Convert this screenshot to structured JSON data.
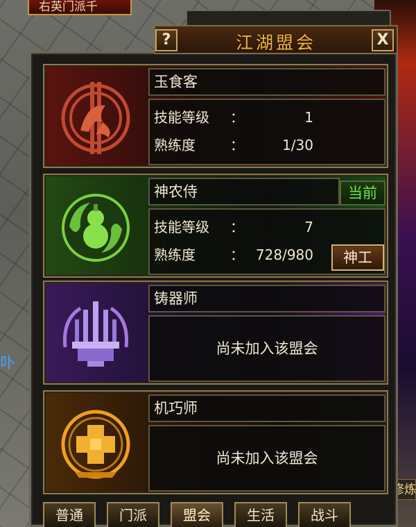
{
  "background": {
    "top_strip_text": "右英门派千",
    "left_fragment_text": "卟",
    "right_fragment_text": "修炼"
  },
  "window": {
    "title": "江湖盟会",
    "help_label": "?",
    "close_label": "X"
  },
  "guilds": [
    {
      "name": "玉食客",
      "skill_level_label": "技能等级",
      "skill_level_value": "1",
      "proficiency_label": "熟练度",
      "proficiency_value": "1/30",
      "color": "#c04a30",
      "icon": "koi-fish-emblem-icon"
    },
    {
      "name": "神农侍",
      "status_badge": "当前",
      "skill_level_label": "技能等级",
      "skill_level_value": "7",
      "proficiency_label": "熟练度",
      "proficiency_value": "728/980",
      "action_button": "神工",
      "color": "#7ad040",
      "icon": "gourd-vine-emblem-icon"
    },
    {
      "name": "铸器师",
      "message": "尚未加入该盟会",
      "color": "#a878e0",
      "icon": "forge-weapons-emblem-icon"
    },
    {
      "name": "机巧师",
      "message": "尚未加入该盟会",
      "color": "#f0a020",
      "icon": "puzzle-cube-emblem-icon"
    }
  ],
  "colon": "：",
  "tabs": [
    {
      "label": "普通",
      "active": false
    },
    {
      "label": "门派",
      "active": false
    },
    {
      "label": "盟会",
      "active": true
    },
    {
      "label": "生活",
      "active": false
    },
    {
      "label": "战斗",
      "active": false
    }
  ]
}
